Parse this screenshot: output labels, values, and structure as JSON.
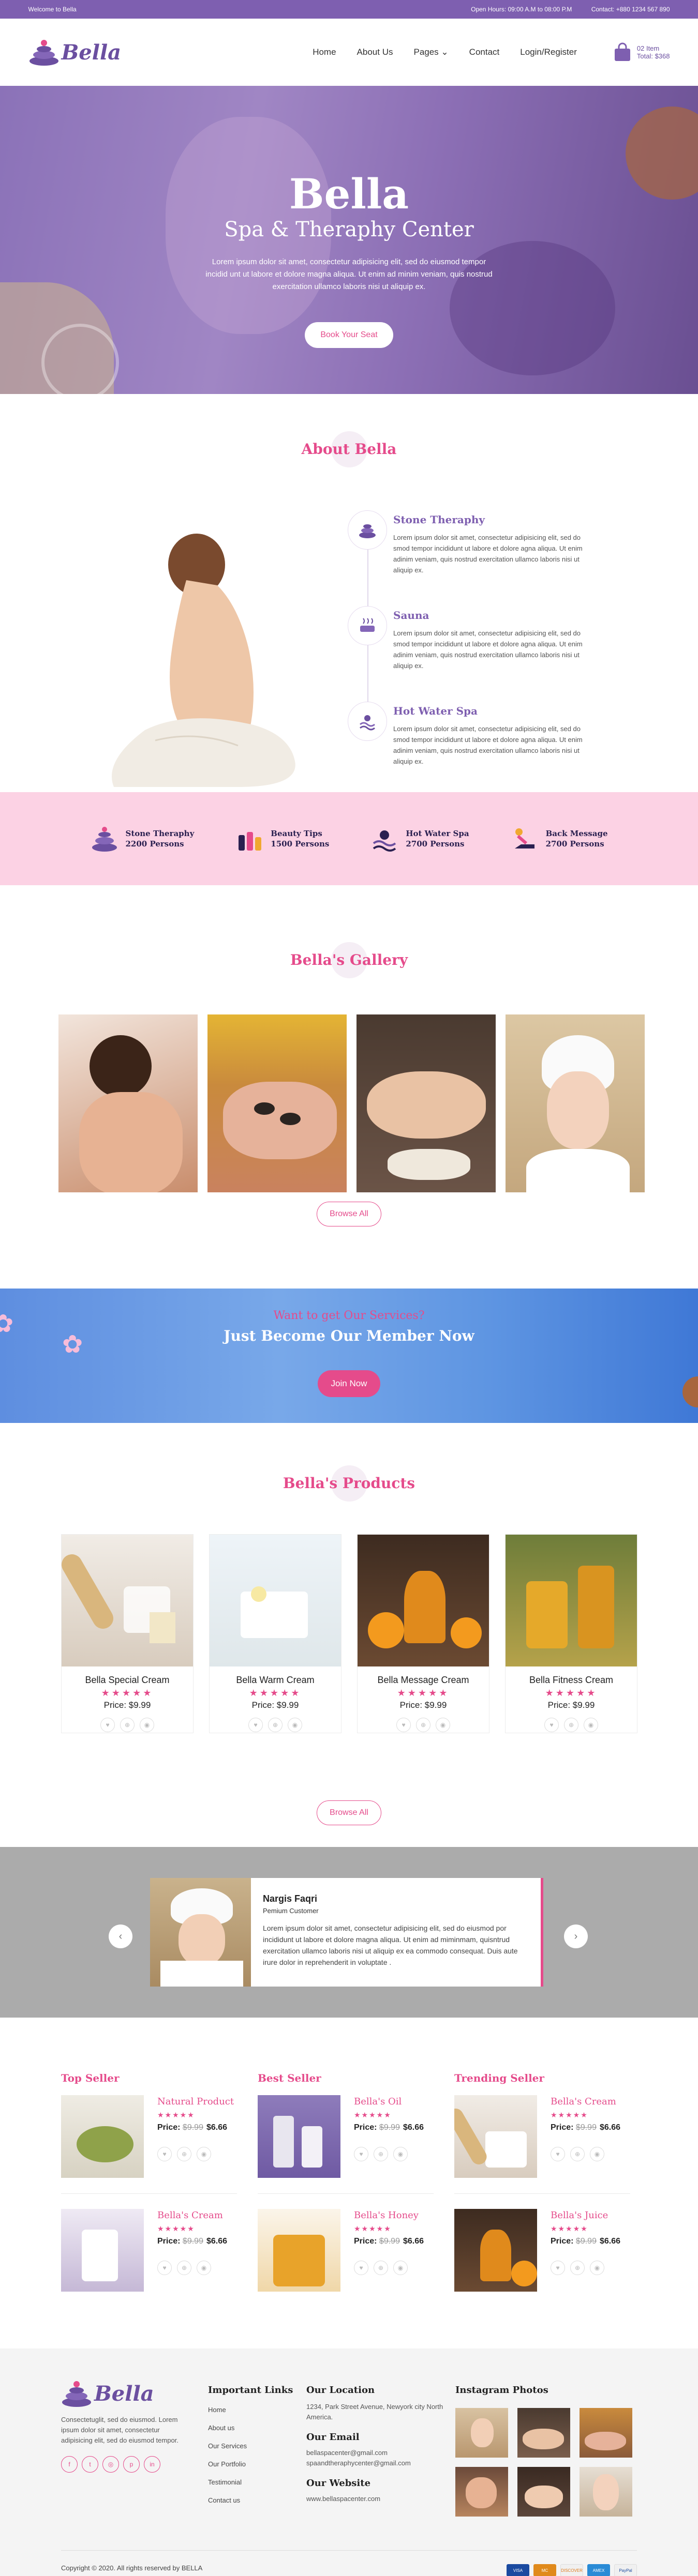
{
  "topbar": {
    "welcome": "Welcome to Bella",
    "hours": "Open Hours: 09:00 A.M to 08:00 P.M",
    "contact": "Contact: +880 1234 567 890"
  },
  "header": {
    "logo_text": "Bella",
    "nav": [
      "Home",
      "About Us",
      "Pages",
      "Contact",
      "Login/Register"
    ],
    "cart_items": "02 Item",
    "cart_total": "Total: $368"
  },
  "hero": {
    "title": "Bella",
    "subtitle": "Spa & Theraphy Center",
    "text": "Lorem ipsum dolor sit amet, consectetur adipisicing elit, sed do eiusmod tempor incidid unt ut labore et dolore magna aliqua. Ut enim ad minim veniam, quis nostrud exercitation ullamco laboris nisi ut aliquip ex.",
    "button": "Book Your Seat"
  },
  "about": {
    "title": "About Bella",
    "items": [
      {
        "title": "Stone Theraphy",
        "icon": "stones-icon",
        "text": "Lorem ipsum dolor sit amet, consectetur adipisicing elit, sed do smod tempor incididunt ut labore et dolore agna aliqua. Ut enim adinim veniam, quis nostrud exercitation ullamco laboris nisi ut aliquip ex."
      },
      {
        "title": "Sauna",
        "icon": "sauna-icon",
        "text": "Lorem ipsum dolor sit amet, consectetur adipisicing elit, sed do smod tempor incididunt ut labore et dolore agna aliqua. Ut enim adinim veniam, quis nostrud exercitation ullamco laboris nisi ut aliquip ex."
      },
      {
        "title": "Hot Water Spa",
        "icon": "hot-water-icon",
        "text": "Lorem ipsum dolor sit amet, consectetur adipisicing elit, sed do smod tempor incididunt ut labore et dolore agna aliqua. Ut enim adinim veniam, quis nostrud exercitation ullamco laboris nisi ut aliquip ex."
      }
    ]
  },
  "stats": [
    {
      "label": "Stone Theraphy",
      "count": "2200 Persons",
      "icon": "stones-icon"
    },
    {
      "label": "Beauty Tips",
      "count": "1500 Persons",
      "icon": "beauty-bottles-icon"
    },
    {
      "label": "Hot Water Spa",
      "count": "2700 Persons",
      "icon": "hot-water-icon"
    },
    {
      "label": "Back Message",
      "count": "2700 Persons",
      "icon": "massage-icon"
    }
  ],
  "gallery": {
    "title": "Bella's Gallery",
    "button": "Browse All"
  },
  "member": {
    "question": "Want to get Our Services?",
    "headline": "Just Become Our Member Now",
    "button": "Join Now"
  },
  "products": {
    "title": "Bella's Products",
    "items": [
      {
        "name": "Bella Special Cream",
        "stars": "★★★★★",
        "price": "Price: $9.99"
      },
      {
        "name": "Bella Warm Cream",
        "stars": "★★★★★",
        "price": "Price: $9.99"
      },
      {
        "name": "Bella Message Cream",
        "stars": "★★★★★",
        "price": "Price: $9.99"
      },
      {
        "name": "Bella Fitness Cream",
        "stars": "★★★★★",
        "price": "Price: $9.99"
      }
    ],
    "button": "Browse All"
  },
  "testimonial": {
    "name": "Nargis Faqri",
    "role": "Pemium Customer",
    "text": "Lorem ipsum dolor sit amet, consectetur adipisicing elit, sed do eiusmod por incididunt ut labore et dolore magna aliqua. Ut enim ad miminmam, quisntrud exercitation ullamco laboris nisi ut aliquip ex ea commodo consequat. Duis aute irure dolor in reprehenderit in voluptate ."
  },
  "sellers": {
    "columns": [
      {
        "title": "Top Seller",
        "items": [
          {
            "name": "Natural Product",
            "stars": "★★★★★",
            "old": "$9.99",
            "price": "$6.66"
          },
          {
            "name": "Bella's Cream",
            "stars": "★★★★★",
            "old": "$9.99",
            "price": "$6.66"
          }
        ]
      },
      {
        "title": "Best Seller",
        "items": [
          {
            "name": "Bella's Oil",
            "stars": "★★★★★",
            "old": "$9.99",
            "price": "$6.66"
          },
          {
            "name": "Bella's Honey",
            "stars": "★★★★★",
            "old": "$9.99",
            "price": "$6.66"
          }
        ]
      },
      {
        "title": "Trending Seller",
        "items": [
          {
            "name": "Bella's Cream",
            "stars": "★★★★★",
            "old": "$9.99",
            "price": "$6.66"
          },
          {
            "name": "Bella's Juice",
            "stars": "★★★★★",
            "old": "$9.99",
            "price": "$6.66"
          }
        ]
      }
    ],
    "price_label": "Price:"
  },
  "footer": {
    "logo_text": "Bella",
    "about": "Consectetuglit, sed do eiusmod. Lorem ipsum dolor sit amet, consectetur adipisicing elit, sed do eiusmod tempor.",
    "links_title": "Important Links",
    "links": [
      "Home",
      "About us",
      "Our Services",
      "Our Portfolio",
      "Testimonial",
      "Contact us"
    ],
    "location_title": "Our Location",
    "location": "1234, Park Street Avenue, Newyork city North America.",
    "email_title": "Our Email",
    "emails": [
      "bellaspacenter@gmail.com",
      "spaandtheraphycenter@gmail.com"
    ],
    "website_title": "Our Website",
    "website": "www.bellaspacenter.com",
    "instagram_title": "Instagram Photos",
    "copyright": "Copyright © 2020. All rights reserved by BELLA",
    "payments": [
      "VISA",
      "MC",
      "DISCOVER",
      "AMEX",
      "PayPal"
    ]
  },
  "colors": {
    "purple": "#7e5fb0",
    "pink": "#e54b8b",
    "stats_bg": "#fcd2e4",
    "member_bg": "#5e8ee0"
  }
}
